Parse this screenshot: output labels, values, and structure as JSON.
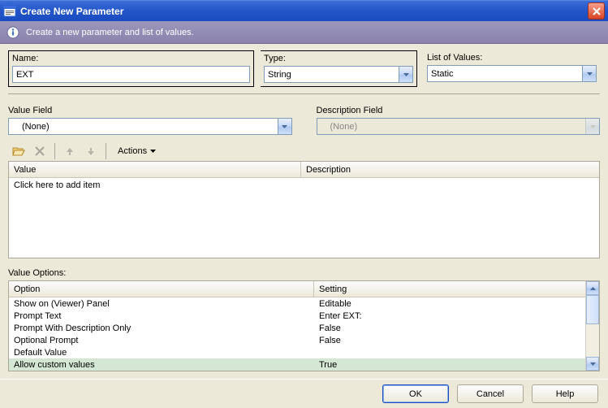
{
  "window": {
    "title": "Create New Parameter",
    "info_text": "Create a new parameter and list of values."
  },
  "fields": {
    "name_label": "Name:",
    "name_value": "EXT",
    "type_label": "Type:",
    "type_value": "String",
    "lov_label": "List of Values:",
    "lov_value": "Static",
    "value_field_label": "Value Field",
    "value_field_value": "(None)",
    "desc_field_label": "Description Field",
    "desc_field_value": "(None)"
  },
  "toolbar": {
    "actions_label": "Actions"
  },
  "list_table": {
    "col_value": "Value",
    "col_desc": "Description",
    "placeholder": "Click here to add item"
  },
  "options": {
    "section_label": "Value Options:",
    "col_option": "Option",
    "col_setting": "Setting",
    "rows": [
      {
        "option": "Show on (Viewer) Panel",
        "setting": "Editable"
      },
      {
        "option": "Prompt Text",
        "setting": "Enter EXT:"
      },
      {
        "option": "Prompt With Description Only",
        "setting": "False"
      },
      {
        "option": "Optional Prompt",
        "setting": "False"
      },
      {
        "option": "Default Value",
        "setting": ""
      },
      {
        "option": "Allow custom values",
        "setting": "True"
      }
    ],
    "selected_index": 5
  },
  "buttons": {
    "ok": "OK",
    "cancel": "Cancel",
    "help": "Help"
  }
}
